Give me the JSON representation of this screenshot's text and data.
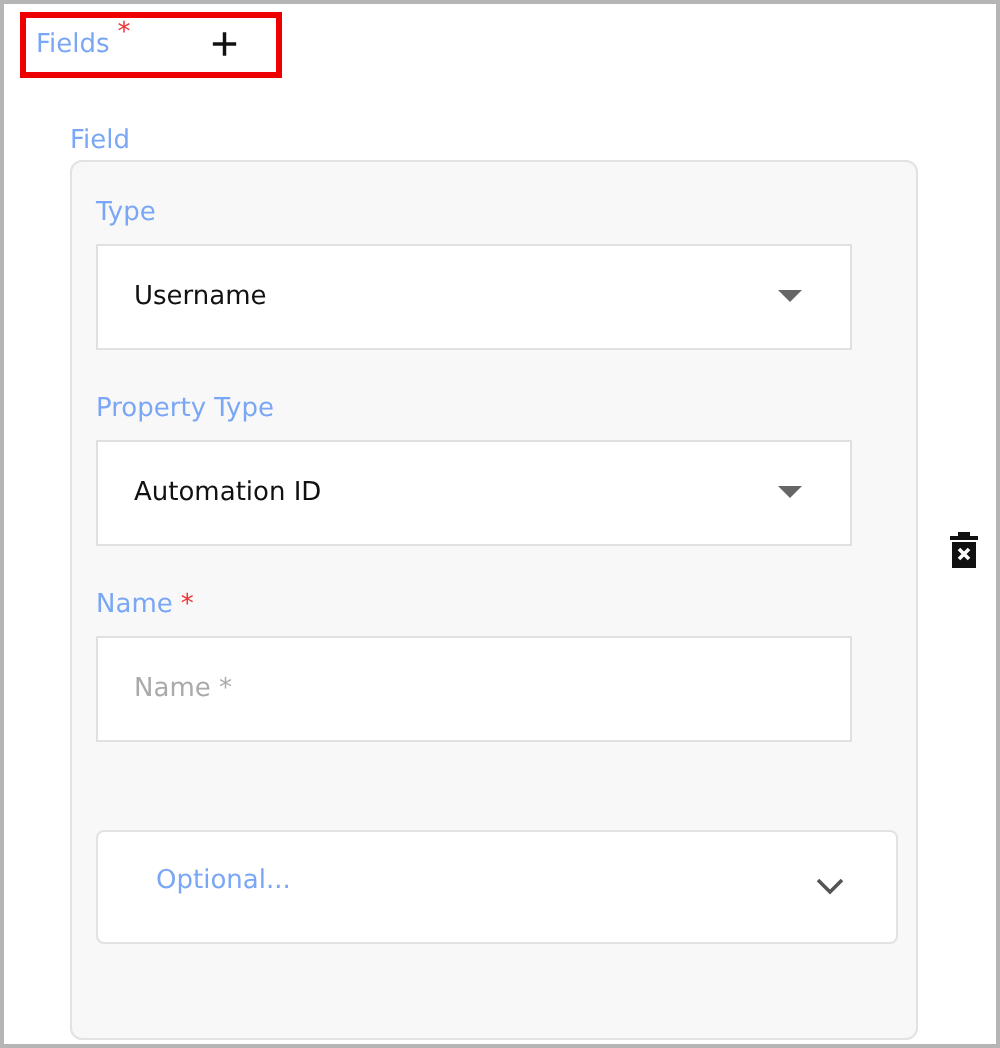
{
  "header": {
    "label": "Fields",
    "required_mark": "*",
    "add_symbol": "+",
    "highlighted": true
  },
  "field_group": {
    "title": "Field",
    "fields": [
      {
        "kind": "select",
        "label": "Type",
        "value": "Username"
      },
      {
        "kind": "select",
        "label": "Property Type",
        "value": "Automation ID"
      },
      {
        "kind": "text",
        "label": "Name",
        "required_mark": "*",
        "placeholder": "Name *"
      }
    ],
    "optional": {
      "label": "Optional...",
      "expanded": false
    }
  }
}
